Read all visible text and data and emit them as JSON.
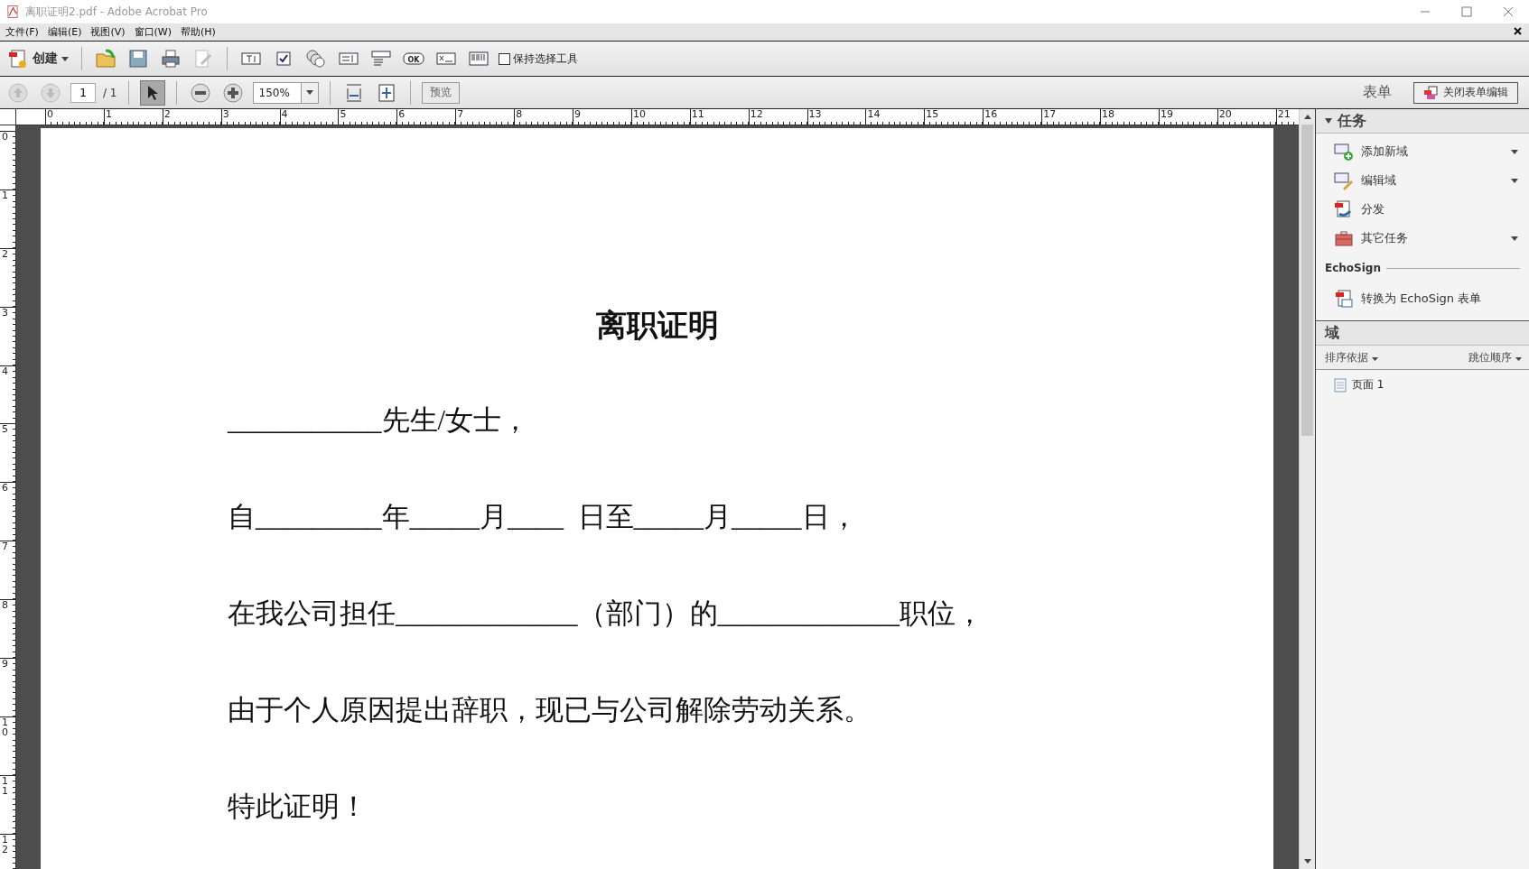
{
  "window": {
    "title": "离职证明2.pdf - Adobe Acrobat Pro"
  },
  "menu": [
    "文件(F)",
    "编辑(E)",
    "视图(V)",
    "窗口(W)",
    "帮助(H)"
  ],
  "toolbar": {
    "create": "创建",
    "button_tool": "OK",
    "keep_tool": {
      "label": "保持选择工具",
      "checked": false
    }
  },
  "navbar": {
    "page": "1",
    "page_count": "/ 1",
    "select_tool": {
      "selected": true
    },
    "zoom": "150%",
    "preview": "预览",
    "forms_label": "表单",
    "close_button": "关闭表单编辑"
  },
  "ruler": {
    "horizontal": [
      "0",
      "1",
      "2",
      "3",
      "4",
      "5",
      "6",
      "7",
      "8",
      "9",
      "10",
      "11",
      "12",
      "13",
      "14",
      "15",
      "16",
      "17",
      "18",
      "19",
      "20",
      "21"
    ],
    "vertical": [
      "0",
      "1",
      "2",
      "3",
      "4",
      "5",
      "6",
      "7",
      "8",
      "9",
      "10",
      "11",
      "12"
    ]
  },
  "document": {
    "title": "离职证明",
    "lines": [
      "___________先生/女士，",
      "自_________年_____月____  日至_____月_____日，",
      "在我公司担任_____________（部门）的_____________职位，",
      "由于个人原因提出辞职，现已与公司解除劳动关系。",
      "特此证明！"
    ]
  },
  "panel": {
    "tasks": {
      "title": "任务",
      "expanded": true,
      "items": [
        {
          "kind": "add",
          "label": "添加新域",
          "menu": true
        },
        {
          "kind": "edit",
          "label": "编辑域",
          "menu": true
        },
        {
          "kind": "distribute",
          "label": "分发",
          "menu": false
        },
        {
          "kind": "other",
          "label": "其它任务",
          "menu": true
        }
      ]
    },
    "echosign": {
      "title": "EchoSign",
      "item": "转换为 EchoSign 表单"
    },
    "fields": {
      "title": "域",
      "sort": "排序依据",
      "order": "跳位顺序",
      "items": [
        {
          "label": "页面 1"
        }
      ]
    }
  }
}
